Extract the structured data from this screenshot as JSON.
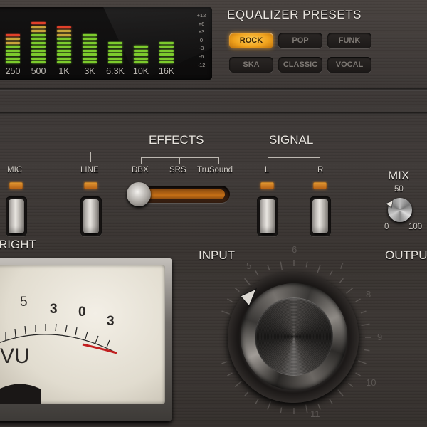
{
  "equalizer": {
    "freq_labels": [
      "250",
      "500",
      "1K",
      "3K",
      "6.3K",
      "10K",
      "16K"
    ],
    "db_labels": [
      "+12",
      "+6",
      "+3",
      "0",
      "-3",
      "-6",
      "-12"
    ]
  },
  "presets": {
    "title": "EQUALIZER PRESETS",
    "buttons": [
      {
        "label": "ROCK",
        "active": true
      },
      {
        "label": "POP",
        "active": false
      },
      {
        "label": "FUNK",
        "active": false
      },
      {
        "label": "SKA",
        "active": false
      },
      {
        "label": "CLASSIC",
        "active": false
      },
      {
        "label": "VOCAL",
        "active": false
      }
    ]
  },
  "sources": {
    "mic": "MIC",
    "line": "LINE"
  },
  "effects": {
    "title": "EFFECTS",
    "options": [
      "DBX",
      "SRS",
      "TruSound"
    ]
  },
  "signal": {
    "title": "SIGNAL",
    "left": "L",
    "right": "R"
  },
  "mix": {
    "title": "MIX",
    "mid": "50",
    "min": "0",
    "max": "100"
  },
  "channel_label": "RIGHT",
  "input_label": "INPUT",
  "output_label": "OUTPU",
  "vu": {
    "scale": [
      "5",
      "3",
      "0",
      "3"
    ],
    "unit": "VU"
  },
  "input_knob": {
    "ticks": [
      "5",
      "6",
      "7",
      "8",
      "9",
      "10",
      "11"
    ]
  },
  "colors": {
    "accent": "#f0a21c",
    "led": "#e59a33",
    "bar_green": "#7ccb2d",
    "bar_red": "#e0402a"
  }
}
